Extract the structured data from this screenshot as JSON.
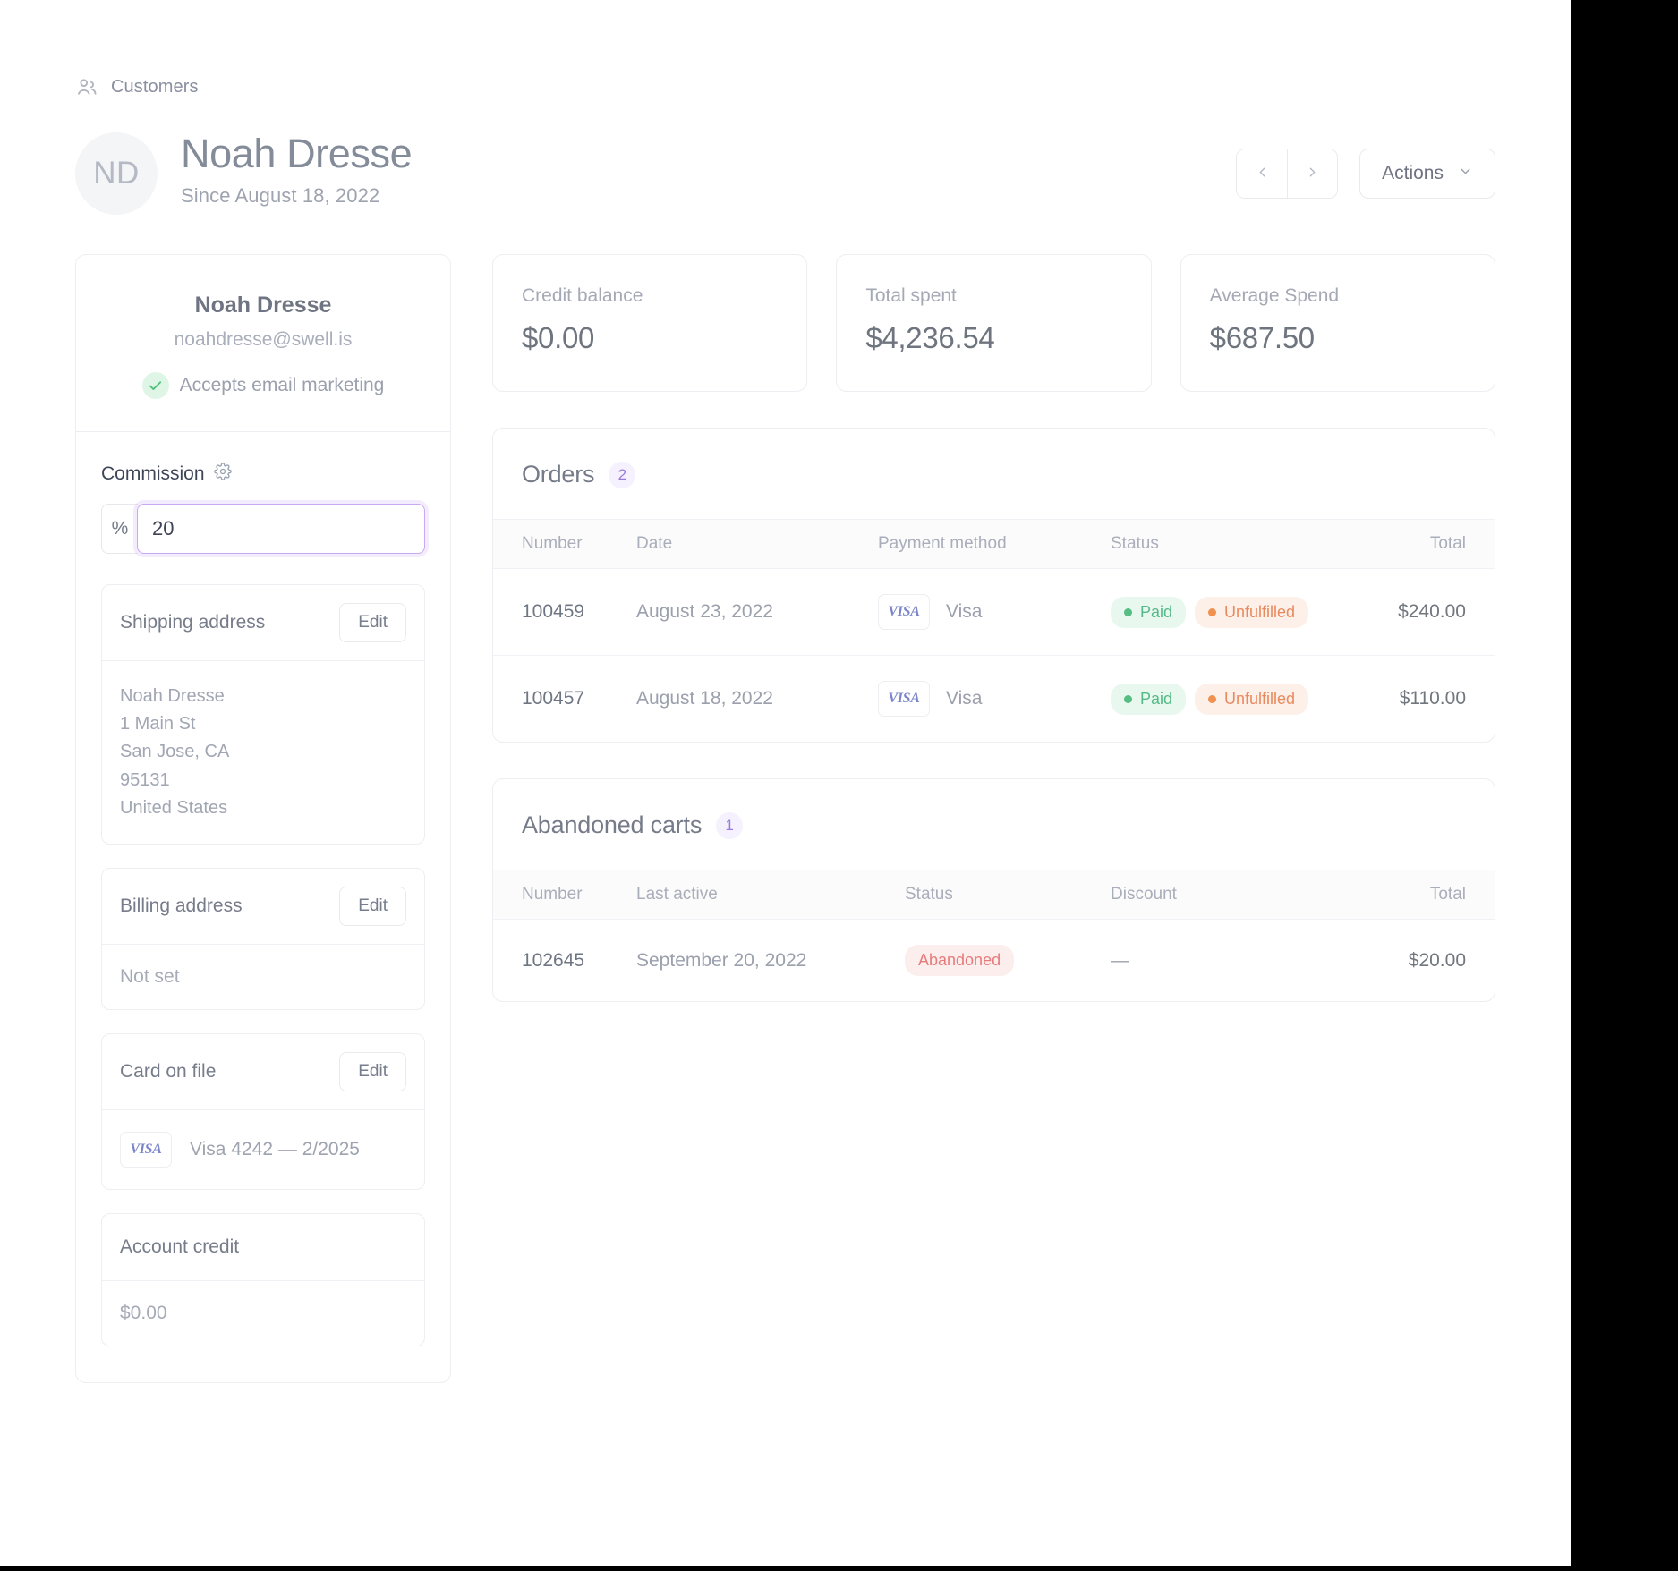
{
  "breadcrumb": {
    "icon": "users-icon",
    "label": "Customers"
  },
  "header": {
    "avatar_initials": "ND",
    "name": "Noah Dresse",
    "since": "Since August 18, 2022",
    "prev_label": "‹",
    "next_label": "›",
    "actions_label": "Actions"
  },
  "profile": {
    "name": "Noah Dresse",
    "email": "noahdresse@swell.is",
    "marketing": "Accepts email marketing",
    "commission": {
      "label": "Commission",
      "settings_icon": "gear-icon",
      "unit": "%",
      "value": "20",
      "placeholder": "0"
    },
    "shipping": {
      "title": "Shipping address",
      "edit_label": "Edit",
      "lines": [
        "Noah Dresse",
        "1 Main St",
        "San Jose, CA",
        "95131",
        "United States"
      ]
    },
    "billing": {
      "title": "Billing address",
      "edit_label": "Edit",
      "value": "Not set"
    },
    "card": {
      "title": "Card on file",
      "edit_label": "Edit",
      "brand": "VISA",
      "label": "Visa 4242 — 2/2025"
    },
    "account_credit": {
      "title": "Account credit",
      "value": "$0.00"
    }
  },
  "stats": [
    {
      "label": "Credit balance",
      "value": "$0.00"
    },
    {
      "label": "Total spent",
      "value": "$4,236.54"
    },
    {
      "label": "Average Spend",
      "value": "$687.50"
    }
  ],
  "orders": {
    "title": "Orders",
    "count": "2",
    "columns": [
      "Number",
      "Date",
      "Payment method",
      "Status",
      "Total"
    ],
    "rows": [
      {
        "number": "100459",
        "date": "August 23, 2022",
        "brand": "VISA",
        "payment_method": "Visa",
        "status_paid": "Paid",
        "status_fulfillment": "Unfulfilled",
        "total": "$240.00"
      },
      {
        "number": "100457",
        "date": "August 18, 2022",
        "brand": "VISA",
        "payment_method": "Visa",
        "status_paid": "Paid",
        "status_fulfillment": "Unfulfilled",
        "total": "$110.00"
      }
    ]
  },
  "abandoned": {
    "title": "Abandoned carts",
    "count": "1",
    "columns": [
      "Number",
      "Last active",
      "Status",
      "Discount",
      "Total"
    ],
    "rows": [
      {
        "number": "102645",
        "last_active": "September 20, 2022",
        "status": "Abandoned",
        "discount": "—",
        "total": "$20.00"
      }
    ]
  },
  "colors": {
    "accent": "#9b7ae0",
    "focus_ring": "#c9a9f2",
    "paid": "#56bd83",
    "unfulfilled": "#f0914f",
    "abandoned": "#e77b7b"
  }
}
